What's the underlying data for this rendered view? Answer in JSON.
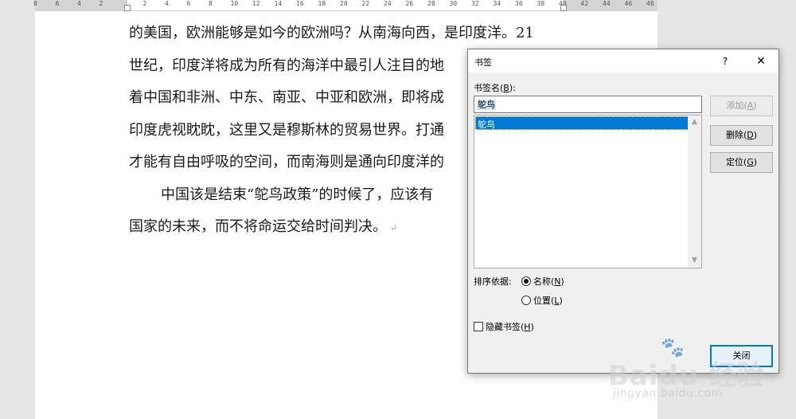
{
  "ruler": {
    "numbers": [
      "8",
      "6",
      "4",
      "2",
      "",
      "2",
      "4",
      "6",
      "8",
      "10",
      "12",
      "14",
      "16",
      "18",
      "20",
      "22",
      "24",
      "26",
      "28",
      "30",
      "32",
      "34",
      "36",
      "38",
      "40",
      "42",
      "44",
      "46",
      "48"
    ]
  },
  "document": {
    "lines": [
      "的美国，欧洲能够是如今的欧洲吗？从南海向西，是印度洋。21",
      "世纪，印度洋将成为所有的海洋中最引人注目的地",
      "着中国和非洲、中东、南亚、中亚和欧洲，即将成",
      "印度虎视眈眈，这里又是穆斯林的贸易世界。打通",
      "才能有自由呼吸的空间，而南海则是通向印度洋的",
      "中国该是结束“鸵鸟政策”的时候了，应该有",
      "国家的未来，而不将命运交给时间判决。"
    ],
    "paragraph_mark": "↵"
  },
  "dialog": {
    "title": "书签",
    "help_label": "?",
    "close_label": "✕",
    "name_label_prefix": "书签名(",
    "name_label_key": "B",
    "name_label_suffix": "):",
    "name_value": "鸵鸟",
    "list_items": [
      "鸵鸟"
    ],
    "add_prefix": "添加(",
    "add_key": "A",
    "add_suffix": ")",
    "delete_prefix": "删除(",
    "delete_key": "D",
    "delete_suffix": ")",
    "goto_prefix": "定位(",
    "goto_key": "G",
    "goto_suffix": ")",
    "sort_label": "排序依据:",
    "sort_name_prefix": "名称(",
    "sort_name_key": "N",
    "sort_name_suffix": ")",
    "sort_location_prefix": "位置(",
    "sort_location_key": "L",
    "sort_location_suffix": ")",
    "hide_prefix": "隐藏书签(",
    "hide_key": "H",
    "hide_suffix": ")",
    "close_button": "关闭",
    "sort_selected": "name"
  },
  "watermark": {
    "brand": "Baidu 经验",
    "url": "jingyan.baidu.com"
  }
}
